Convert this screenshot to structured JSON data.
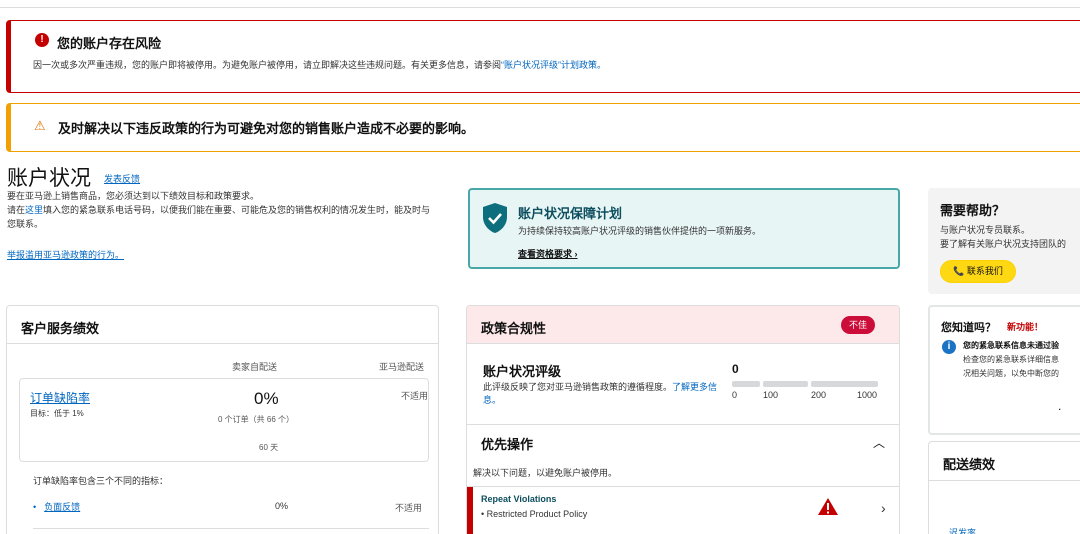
{
  "alert_risk": {
    "title": "您的账户存在风险",
    "icon": "alert-circle-icon",
    "body": "因一次或多次严重违规，您的账户即将被停用。为避免账户被停用，请立即解决这些违规问题。有关更多信息，请参阅",
    "link": "“账户状况评级”计划政策。"
  },
  "alert_policy": {
    "icon": "warning-triangle-icon",
    "title": "及时解决以下违反政策的行为可避免对您的销售账户造成不必要的影响。"
  },
  "page": {
    "title": "账户状况",
    "feedback": "发表反馈",
    "intro_1": "要在亚马逊上销售商品，您必须达到以下绩效目标和政策要求。",
    "intro_2a": "请在",
    "intro_2_link": "这里",
    "intro_2b": "填入您的紧急联系电话号码，以便我们能在重要、可能危及您的销售权利的情况发生时，能及时与您联系。",
    "report_link": "举报滥用亚马逊政策的行为。"
  },
  "ahp": {
    "title": "账户状况保障计划",
    "subtitle": "为持续保持较高账户状况评级的销售伙伴提供的一项新服务。",
    "link": "查看资格要求"
  },
  "help": {
    "title": "需要帮助？",
    "line1": "与账户状况专员联系。",
    "line2": "要了解有关账户状况支持团队的",
    "button": "联系我们"
  },
  "customer_service": {
    "title": "客户服务绩效",
    "col_seller": "卖家自配送",
    "col_amazon": "亚马逊配送",
    "odr": {
      "name": "订单缺陷率",
      "target": "目标：低于 1%",
      "value": "0%",
      "orders": "0 个订单（共 66 个）",
      "days": "60 天",
      "amazon": "不适用"
    },
    "note": "订单缺陷率包含三个不同的指标：",
    "negative": {
      "label": "负面反馈",
      "value": "0%",
      "amazon": "不适用"
    }
  },
  "policy": {
    "title": "政策合规性",
    "badge": "不佳",
    "ahr_title": "账户状况评级",
    "ahr_desc": "此评级反映了您对亚马逊销售政策的遵循程度。",
    "ahr_link": "了解更多信息。",
    "ahr_score": "0",
    "scale": [
      "0",
      "100",
      "200",
      "1000"
    ],
    "priority_title": "优先操作",
    "priority_desc": "解决以下问题，以避免账户被停用。",
    "violation_title": "Repeat Violations",
    "violation_sub": "• Restricted Product Policy"
  },
  "did_you_know": {
    "title": "您知道吗？",
    "new": "新功能！",
    "l1": "您的紧急联系信息未通过验",
    "l2": "检查您的紧急联系详细信息",
    "l3": "况相关问题，以免中断您的",
    "dot": "."
  },
  "delivery": {
    "title": "配送绩效",
    "link": "迟发率"
  },
  "colors": {
    "red": "#c40000",
    "orange": "#f0a000",
    "teal": "#4aa7a7",
    "link": "#0066c0",
    "yellow": "#ffd814"
  }
}
